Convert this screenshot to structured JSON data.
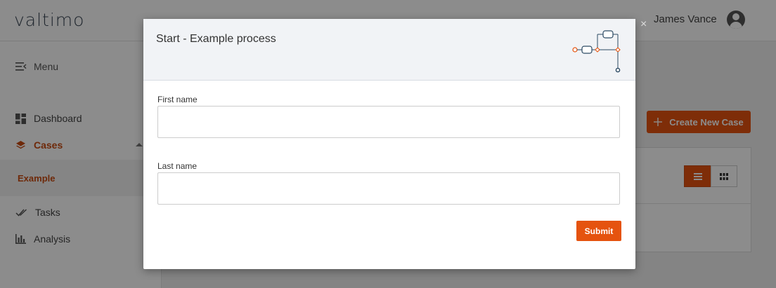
{
  "app": {
    "logo": "valtimo"
  },
  "header": {
    "user_name": "James Vance"
  },
  "sidebar": {
    "menu_label": "Menu",
    "items": [
      {
        "label": "Dashboard",
        "icon": "dashboard-icon"
      },
      {
        "label": "Cases",
        "icon": "layers-icon",
        "active": true
      },
      {
        "label": "Tasks",
        "icon": "double-check-icon"
      },
      {
        "label": "Analysis",
        "icon": "bar-chart-icon"
      }
    ],
    "sub_items": [
      {
        "label": "Example",
        "active": true
      }
    ]
  },
  "main": {
    "create_button_label": "Create New Case",
    "view_options": [
      "list",
      "grid"
    ]
  },
  "modal": {
    "title": "Start - Example process",
    "fields": [
      {
        "label": "First name",
        "value": "",
        "placeholder": ""
      },
      {
        "label": "Last name",
        "value": "",
        "placeholder": ""
      }
    ],
    "submit_label": "Submit",
    "close_symbol": "×"
  },
  "colors": {
    "accent": "#e5530f",
    "accent_text": "#c84b12",
    "header_bg": "#f1f3f6",
    "diagram_blue": "#2c4a63"
  }
}
